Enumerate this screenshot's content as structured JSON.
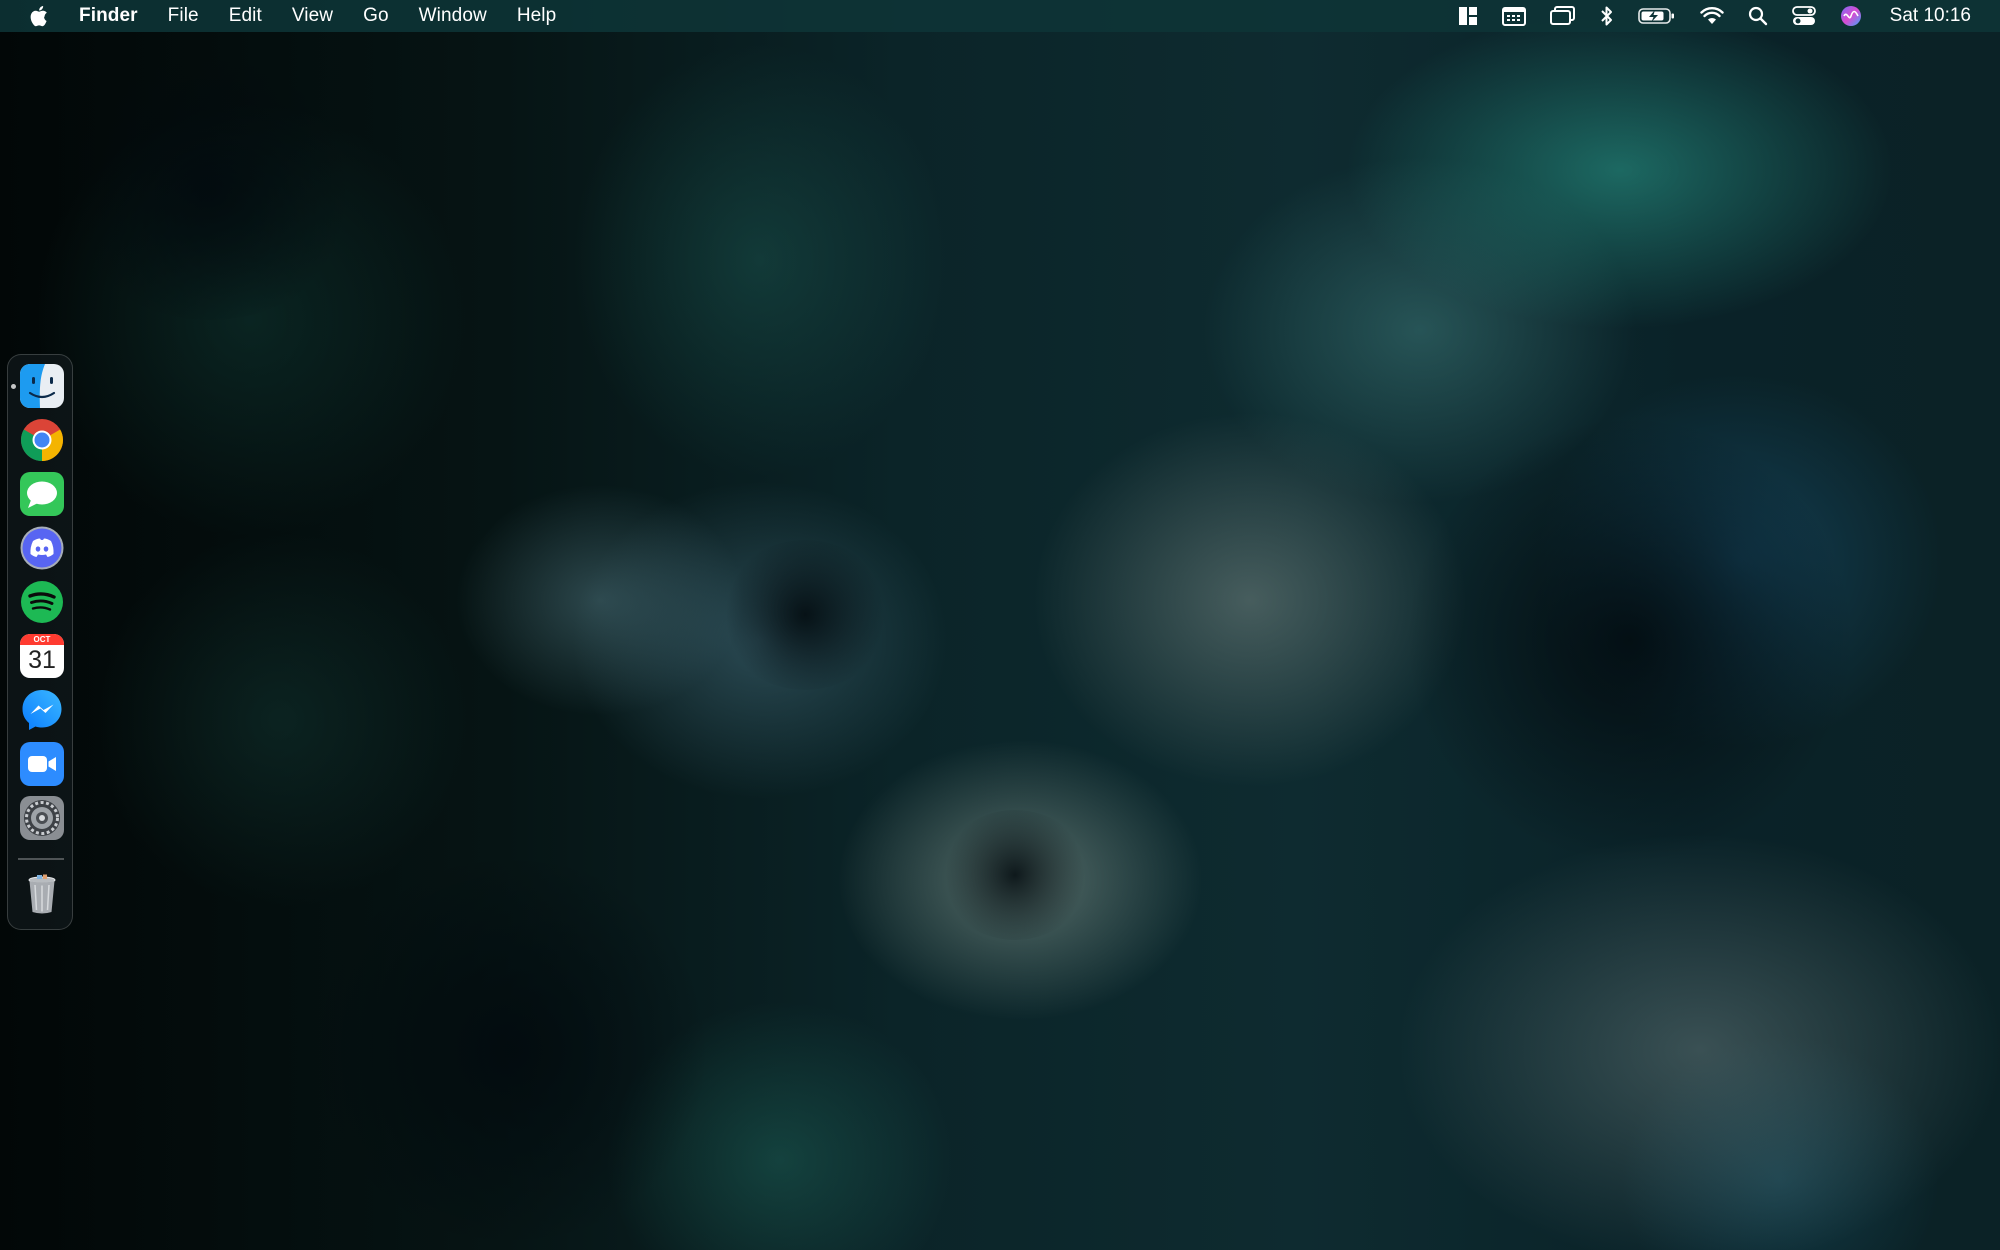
{
  "menubar": {
    "app_name": "Finder",
    "menus": [
      "File",
      "Edit",
      "View",
      "Go",
      "Window",
      "Help"
    ],
    "status_icons": [
      "window-layout-icon",
      "calendar-widget-icon",
      "screen-mirroring-icon",
      "bluetooth-icon",
      "battery-charging-icon",
      "wifi-icon",
      "spotlight-search-icon",
      "control-center-icon",
      "siri-icon"
    ],
    "clock": "Sat 10:16"
  },
  "dock": {
    "apps": [
      {
        "name": "Finder",
        "icon": "finder-icon",
        "running": true
      },
      {
        "name": "Google Chrome",
        "icon": "chrome-icon",
        "running": false
      },
      {
        "name": "Messages",
        "icon": "messages-icon",
        "running": false
      },
      {
        "name": "Discord",
        "icon": "discord-icon",
        "running": false
      },
      {
        "name": "Spotify",
        "icon": "spotify-icon",
        "running": false
      },
      {
        "name": "Calendar",
        "icon": "calendar-icon",
        "running": false
      },
      {
        "name": "Messenger",
        "icon": "messenger-icon",
        "running": false
      },
      {
        "name": "Zoom",
        "icon": "zoom-icon",
        "running": false
      },
      {
        "name": "System Preferences",
        "icon": "system-preferences-icon",
        "running": false
      }
    ],
    "trash": {
      "name": "Trash",
      "icon": "trash-icon"
    },
    "calendar_month": "OCT",
    "calendar_day": "31"
  },
  "colors": {
    "menubar_bg": "#0e3437",
    "chrome_red": "#db4437",
    "chrome_yellow": "#f4b400",
    "chrome_green": "#0f9d58",
    "chrome_blue": "#4285f4",
    "messages_green": "#34c759",
    "discord_blurple": "#5865f2",
    "spotify_green": "#1db954",
    "messenger_blue": "#0a7cff",
    "zoom_blue": "#2d8cff",
    "calendar_red": "#ff3b30"
  }
}
